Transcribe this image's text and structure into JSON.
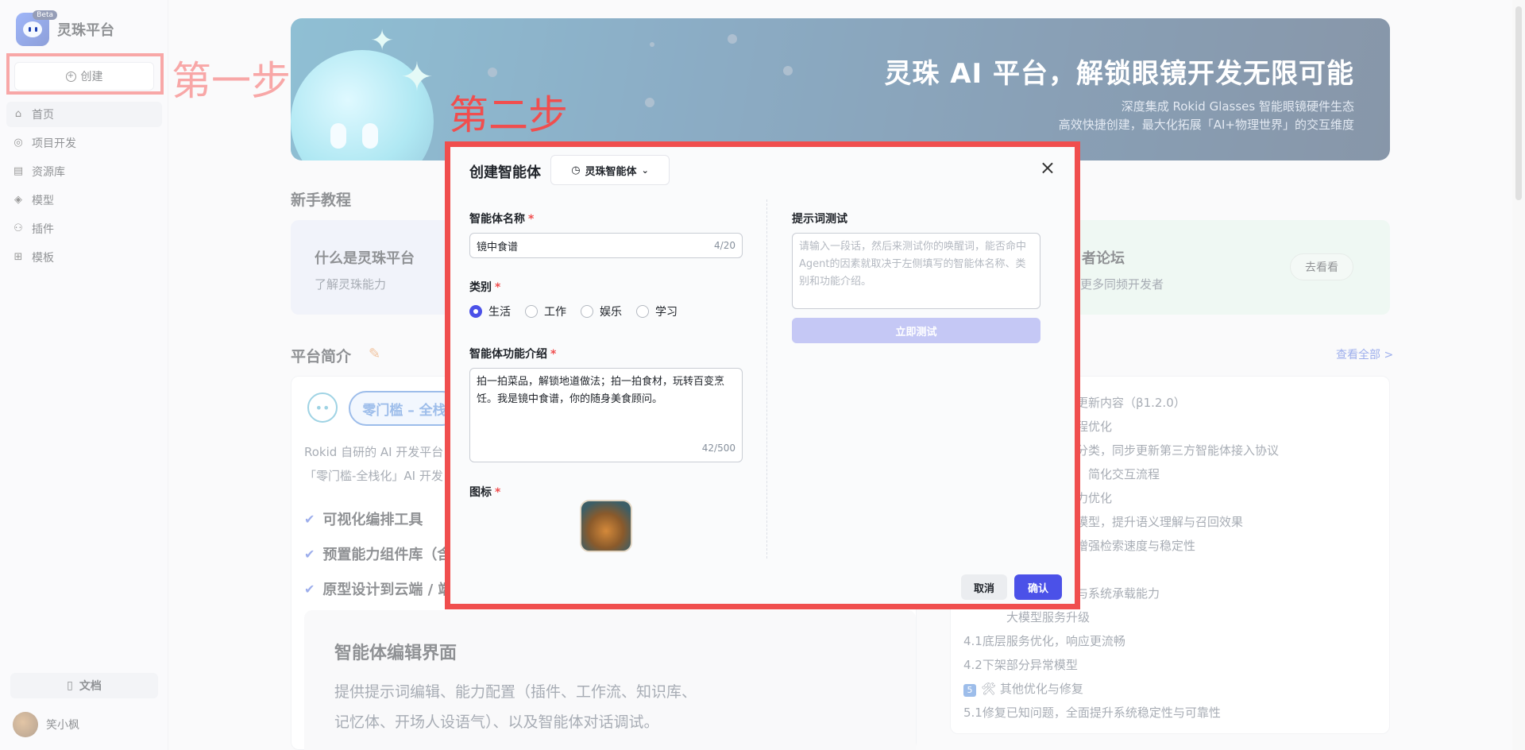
{
  "app": {
    "name": "灵珠平台",
    "beta": "Beta"
  },
  "sidebar": {
    "create_label": "创建",
    "items": [
      {
        "label": "首页",
        "icon": "home-icon"
      },
      {
        "label": "项目开发",
        "icon": "gamepad-icon"
      },
      {
        "label": "资源库",
        "icon": "library-icon"
      },
      {
        "label": "模型",
        "icon": "model-icon"
      },
      {
        "label": "插件",
        "icon": "plugin-icon"
      },
      {
        "label": "模板",
        "icon": "template-icon"
      }
    ],
    "docs_label": "文档",
    "user_name": "笑小枫"
  },
  "annotations": {
    "step1": "第一步",
    "step2": "第二步"
  },
  "banner": {
    "title": "灵珠 AI 平台，解锁眼镜开发无限可能",
    "sub1": "深度集成 Rokid Glasses 智能眼镜硬件生态",
    "sub2": "高效快捷创建，最大化拓展「AI+物理世界」的交互维度"
  },
  "tutorials": {
    "title": "新手教程",
    "card1_title": "什么是灵珠平台",
    "card1_desc": "了解灵珠能力",
    "card3_title": "者论坛",
    "card3_desc": "更多同频开发者",
    "card3_button": "去看看"
  },
  "intro": {
    "title": "平台简介",
    "tag": "零门槛 – 全栈",
    "text1": "Rokid 自研的 AI 开发平台",
    "text2": "「零门槛-全栈化」AI 开发",
    "features": [
      "可视化编排工具",
      "预置能力组件库（含",
      "原型设计到云端 / 端"
    ],
    "editor_title": "智能体编辑界面",
    "editor_desc1": "提供提示词编辑、能力配置（插件、工作流、知识库、",
    "editor_desc2": "记忆体、开场人设语气）、以及智能体对话调试。"
  },
  "changelog": {
    "view_all": "查看全部 >",
    "lines": [
      "更新内容（β1.2.0）",
      "程优化",
      "分类，同步更新第三方智能体接入协议",
      "，简化交互流程",
      "力优化",
      "模型，提升语义理解与召回效果",
      "增强检索速度与稳定性",
      "与系统承载能力",
      "大模型服务升级",
      "4.1底层服务优化，响应更流畅",
      "4.2下架部分异常模型",
      "其他优化与修复",
      "5.1修复已知问题，全面提升系统稳定性与可靠性"
    ],
    "badge5": "5"
  },
  "dialog": {
    "title": "创建智能体",
    "type_label": "灵珠智能体",
    "name_label": "智能体名称",
    "name_value": "镜中食谱",
    "name_count": "4/20",
    "category_label": "类别",
    "categories": [
      "生活",
      "工作",
      "娱乐",
      "学习"
    ],
    "selected_category": "生活",
    "desc_label": "智能体功能介绍",
    "desc_value": "拍一拍菜品，解锁地道做法；拍一拍食材，玩转百变烹饪。我是镜中食谱，你的随身美食顾问。",
    "desc_count": "42/500",
    "icon_label": "图标",
    "prompt_label": "提示词测试",
    "prompt_placeholder": "请输入一段话，然后来测试你的唤醒词，能否命中Agent的因素就取决于左侧填写的智能体名称、类别和功能介绍。",
    "test_button": "立即测试",
    "cancel_button": "取消",
    "ok_button": "确认",
    "required_mark": "*"
  }
}
